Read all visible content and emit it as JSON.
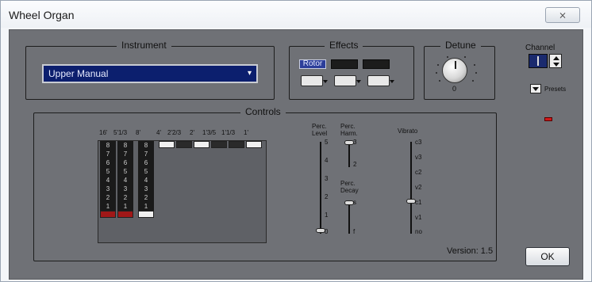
{
  "window": {
    "title": "Wheel Organ",
    "close_glyph": "⨯"
  },
  "instrument": {
    "legend": "Instrument",
    "selected": "Upper Manual",
    "dropdown_icon": "chevron-down-icon"
  },
  "effects": {
    "legend": "Effects",
    "buttons": [
      "Rotor",
      "",
      ""
    ],
    "active": "Rotor"
  },
  "detune": {
    "legend": "Detune",
    "value_label": "0"
  },
  "controls": {
    "legend": "Controls",
    "drawbar_labels": [
      "16'",
      "5'1/3",
      "8'",
      "4'",
      "2'2/3",
      "2'",
      "1'3/5",
      "1'1/3",
      "1'"
    ],
    "drawbar_values": [
      8,
      8,
      8,
      0,
      0,
      0,
      0,
      0,
      0
    ],
    "drawbar_numbers": [
      "8",
      "7",
      "6",
      "5",
      "4",
      "3",
      "2",
      "1"
    ],
    "drawbar_cap_colors": [
      "#a01818",
      "#a01818",
      "#f0f0f0",
      "#f0f0f0",
      "#2a2a2a",
      "#f0f0f0",
      "#2a2a2a",
      "#2a2a2a",
      "#f0f0f0"
    ],
    "perc_level": {
      "label_line1": "Perc.",
      "label_line2": "Level",
      "ticks": [
        "5",
        "4",
        "3",
        "2",
        "1",
        "0"
      ],
      "value": "0"
    },
    "perc_harm": {
      "label_line1": "Perc.",
      "label_line2": "Harm.",
      "ticks": [
        "3",
        "2"
      ],
      "value": "3"
    },
    "perc_decay": {
      "label_line1": "Perc.",
      "label_line2": "Decay",
      "ticks": [
        "s",
        "f"
      ],
      "value": "s"
    },
    "vibrato": {
      "label": "Vibrato",
      "ticks": [
        "c3",
        "v3",
        "c2",
        "v2",
        "c1",
        "v1",
        "no"
      ],
      "value": "c1"
    }
  },
  "channel": {
    "label": "Channel",
    "presets_label": "Presets"
  },
  "footer": {
    "version": "Version: 1.5",
    "ok_label": "OK"
  }
}
